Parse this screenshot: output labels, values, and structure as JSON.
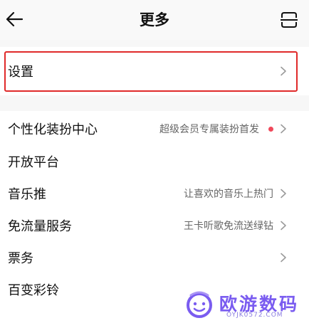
{
  "header": {
    "title": "更多"
  },
  "settings": {
    "label": "设置"
  },
  "list": [
    {
      "label": "个性化装扮中心",
      "sub": "超级会员专属装扮首发",
      "badge": true
    },
    {
      "label": "开放平台",
      "sub": "",
      "badge": false
    },
    {
      "label": "音乐推",
      "sub": "让喜欢的音乐上热门",
      "badge": false
    },
    {
      "label": "免流量服务",
      "sub": "王卡听歌免流送绿钻",
      "badge": false
    },
    {
      "label": "票务",
      "sub": "",
      "badge": false
    },
    {
      "label": "百变彩铃",
      "sub": "",
      "badge": false
    }
  ],
  "watermark": {
    "text": "欧游数码",
    "sub": "OYJK0572.COM"
  },
  "colors": {
    "highlight": "#e02a2a",
    "badge": "#f0485a",
    "watermark": "#7a5cf0"
  },
  "icons": {
    "back": "arrow-left-icon",
    "scan": "scan-icon",
    "chevron": "chevron-right-icon"
  }
}
